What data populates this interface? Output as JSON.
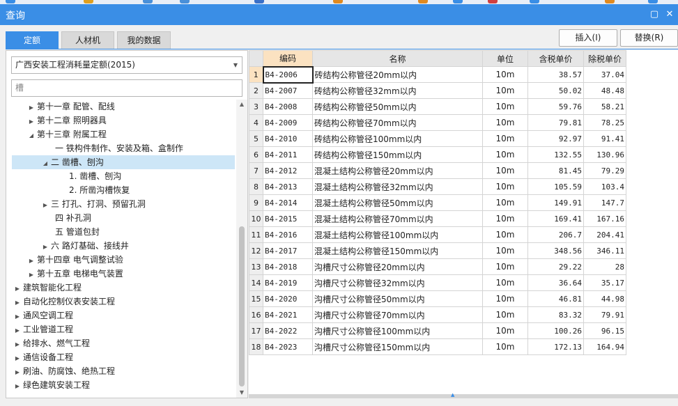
{
  "window": {
    "title": "查询"
  },
  "tabs": [
    {
      "label": "定额",
      "active": true
    },
    {
      "label": "人材机",
      "active": false
    },
    {
      "label": "我的数据",
      "active": false
    }
  ],
  "actions": {
    "insert": "插入(I)",
    "replace": "替换(R)"
  },
  "library_select": {
    "value": "广西安装工程消耗量定额(2015)"
  },
  "search": {
    "value": "槽"
  },
  "tree": [
    {
      "label": "第十一章 配管、配线",
      "toggle": "▶"
    },
    {
      "label": "第十二章 照明器具",
      "toggle": "▶"
    },
    {
      "label": "第十三章 附属工程",
      "toggle": "◢"
    },
    {
      "label": "一 铁构件制作、安装及箱、盒制作",
      "toggle": ""
    },
    {
      "label": "二 凿槽、刨沟",
      "toggle": "◢",
      "selected": true
    },
    {
      "label": "1. 凿槽、刨沟",
      "toggle": ""
    },
    {
      "label": "2. 所凿沟槽恢复",
      "toggle": ""
    },
    {
      "label": "三 打孔、打洞、预留孔洞",
      "toggle": "▶"
    },
    {
      "label": "四 补孔洞",
      "toggle": ""
    },
    {
      "label": "五 管道包封",
      "toggle": ""
    },
    {
      "label": "六 路灯基础、接线井",
      "toggle": "▶"
    },
    {
      "label": "第十四章 电气调整试验",
      "toggle": "▶"
    },
    {
      "label": "第十五章 电梯电气装置",
      "toggle": "▶"
    },
    {
      "label": "建筑智能化工程",
      "toggle": "▶"
    },
    {
      "label": "自动化控制仪表安装工程",
      "toggle": "▶"
    },
    {
      "label": "通风空调工程",
      "toggle": "▶"
    },
    {
      "label": "工业管道工程",
      "toggle": "▶"
    },
    {
      "label": "给排水、燃气工程",
      "toggle": "▶"
    },
    {
      "label": "通信设备工程",
      "toggle": "▶"
    },
    {
      "label": "刷油、防腐蚀、绝热工程",
      "toggle": "▶"
    },
    {
      "label": "绿色建筑安装工程",
      "toggle": "▶"
    }
  ],
  "table": {
    "headers": [
      "编码",
      "名称",
      "单位",
      "含税单价",
      "除税单价"
    ],
    "rows": [
      {
        "no": "1",
        "code": "B4-2006",
        "name": "砖结构公称管径20mm以内",
        "unit": "10m",
        "tax": "38.57",
        "notax": "37.04"
      },
      {
        "no": "2",
        "code": "B4-2007",
        "name": "砖结构公称管径32mm以内",
        "unit": "10m",
        "tax": "50.02",
        "notax": "48.48"
      },
      {
        "no": "3",
        "code": "B4-2008",
        "name": "砖结构公称管径50mm以内",
        "unit": "10m",
        "tax": "59.76",
        "notax": "58.21"
      },
      {
        "no": "4",
        "code": "B4-2009",
        "name": "砖结构公称管径70mm以内",
        "unit": "10m",
        "tax": "79.81",
        "notax": "78.25"
      },
      {
        "no": "5",
        "code": "B4-2010",
        "name": "砖结构公称管径100mm以内",
        "unit": "10m",
        "tax": "92.97",
        "notax": "91.41"
      },
      {
        "no": "6",
        "code": "B4-2011",
        "name": "砖结构公称管径150mm以内",
        "unit": "10m",
        "tax": "132.55",
        "notax": "130.96"
      },
      {
        "no": "7",
        "code": "B4-2012",
        "name": "混凝土结构公称管径20mm以内",
        "unit": "10m",
        "tax": "81.45",
        "notax": "79.29"
      },
      {
        "no": "8",
        "code": "B4-2013",
        "name": "混凝土结构公称管径32mm以内",
        "unit": "10m",
        "tax": "105.59",
        "notax": "103.4"
      },
      {
        "no": "9",
        "code": "B4-2014",
        "name": "混凝土结构公称管径50mm以内",
        "unit": "10m",
        "tax": "149.91",
        "notax": "147.7"
      },
      {
        "no": "10",
        "code": "B4-2015",
        "name": "混凝土结构公称管径70mm以内",
        "unit": "10m",
        "tax": "169.41",
        "notax": "167.16"
      },
      {
        "no": "11",
        "code": "B4-2016",
        "name": "混凝土结构公称管径100mm以内",
        "unit": "10m",
        "tax": "206.7",
        "notax": "204.41"
      },
      {
        "no": "12",
        "code": "B4-2017",
        "name": "混凝土结构公称管径150mm以内",
        "unit": "10m",
        "tax": "348.56",
        "notax": "346.11"
      },
      {
        "no": "13",
        "code": "B4-2018",
        "name": "沟槽尺寸公称管径20mm以内",
        "unit": "10m",
        "tax": "29.22",
        "notax": "28"
      },
      {
        "no": "14",
        "code": "B4-2019",
        "name": "沟槽尺寸公称管径32mm以内",
        "unit": "10m",
        "tax": "36.64",
        "notax": "35.17"
      },
      {
        "no": "15",
        "code": "B4-2020",
        "name": "沟槽尺寸公称管径50mm以内",
        "unit": "10m",
        "tax": "46.81",
        "notax": "44.98"
      },
      {
        "no": "16",
        "code": "B4-2021",
        "name": "沟槽尺寸公称管径70mm以内",
        "unit": "10m",
        "tax": "83.32",
        "notax": "79.91"
      },
      {
        "no": "17",
        "code": "B4-2022",
        "name": "沟槽尺寸公称管径100mm以内",
        "unit": "10m",
        "tax": "100.26",
        "notax": "96.15"
      },
      {
        "no": "18",
        "code": "B4-2023",
        "name": "沟槽尺寸公称管径150mm以内",
        "unit": "10m",
        "tax": "172.13",
        "notax": "164.94"
      }
    ]
  },
  "colors": {
    "accent": "#3a8ee6",
    "selected_row": "#cde6f7",
    "current_cell": "#fbe2c1"
  }
}
